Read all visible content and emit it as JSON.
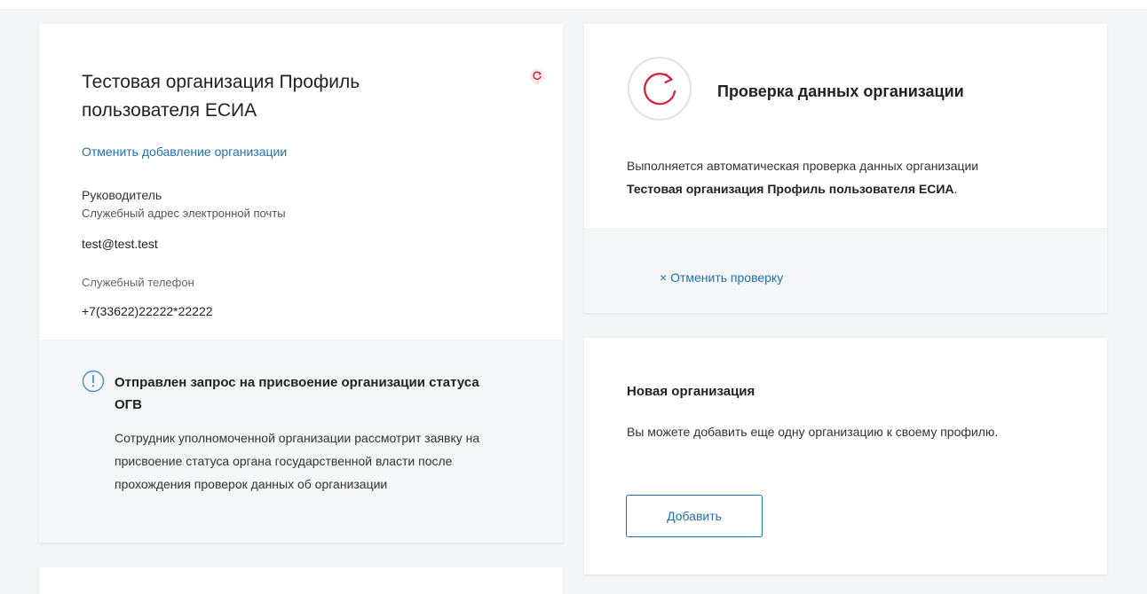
{
  "organization": {
    "title": "Тестовая организация Профиль пользователя ЕСИА",
    "cancel_link": "Отменить добавление организации",
    "position": "Руководитель",
    "email_label": "Служебный адрес электронной почты",
    "email": "test@test.test",
    "phone_label": "Служебный телефон",
    "phone": "+7(33622)22222*22222",
    "status_icon": "refresh-status-icon",
    "notice": {
      "title": "Отправлен запрос на присвоение организации статуса ОГВ",
      "text": "Сотрудник уполномоченной организации рассмотрит заявку на присвоение статуса органа государственной власти после прохождения проверок данных об организации",
      "icon": "info-icon"
    }
  },
  "verification": {
    "title": "Проверка данных организации",
    "text_line1": "Выполняется автоматическая проверка данных организации",
    "org_name": "Тестовая организация Профиль пользователя ЕСИА",
    "org_name_suffix": ".",
    "cancel_label": "× Отменить проверку",
    "icon": "refresh-icon"
  },
  "new_org": {
    "title": "Новая организация",
    "text": "Вы можете добавить еще одну организацию к своему профилю.",
    "add_button": "Добавить"
  },
  "colors": {
    "link": "#1f6fb2",
    "accent_red": "#d3213a",
    "panel_gray": "#f5f6f7"
  }
}
